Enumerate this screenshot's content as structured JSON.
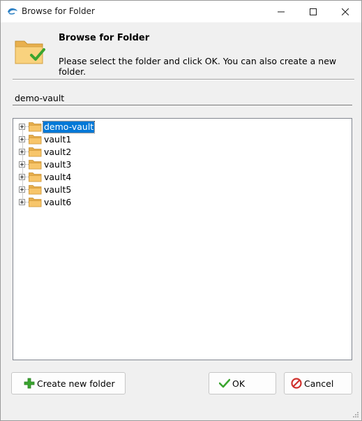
{
  "window": {
    "title": "Browse for Folder",
    "controls": {
      "minimize": "minimize-icon",
      "maximize": "maximize-icon",
      "close": "close-icon"
    }
  },
  "header": {
    "title": "Browse for Folder",
    "description": "Please select the folder and click OK. You can also create a new folder.",
    "icon": "folder-check-icon"
  },
  "path": {
    "value": "demo-vault"
  },
  "tree": {
    "items": [
      {
        "label": "demo-vault",
        "selected": true
      },
      {
        "label": "vault1",
        "selected": false
      },
      {
        "label": "vault2",
        "selected": false
      },
      {
        "label": "vault3",
        "selected": false
      },
      {
        "label": "vault4",
        "selected": false
      },
      {
        "label": "vault5",
        "selected": false
      },
      {
        "label": "vault6",
        "selected": false
      }
    ]
  },
  "buttons": {
    "create_label": "Create new folder",
    "ok_label": "OK",
    "cancel_label": "Cancel"
  },
  "colors": {
    "selection": "#0078d7",
    "folder": "#f7c56a",
    "ok_check": "#3aa52f",
    "cancel": "#d0312d",
    "create_plus": "#3aa52f"
  }
}
